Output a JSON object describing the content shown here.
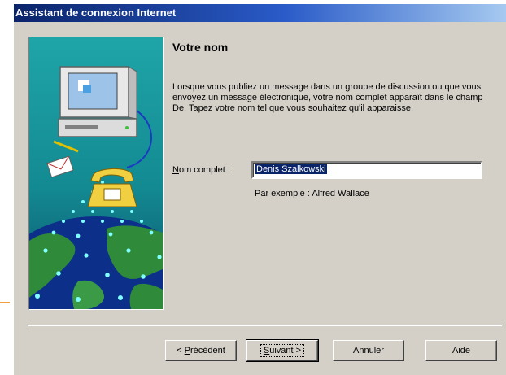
{
  "window": {
    "title": "Assistant de connexion Internet"
  },
  "page": {
    "heading": "Votre nom",
    "description": "Lorsque vous publiez un message dans un groupe de discussion ou que vous envoyez un message électronique, votre nom complet apparaît dans le champ De. Tapez votre nom tel que vous souhaitez qu'il apparaisse.",
    "name_label_accel": "N",
    "name_label_rest": "om complet :",
    "name_value": "Denis Szalkowski",
    "example": "Par exemple : Alfred Wallace"
  },
  "buttons": {
    "back_prefix": "< ",
    "back_accel": "P",
    "back_rest": "récédent",
    "next_accel": "S",
    "next_rest": "uivant >",
    "cancel": "Annuler",
    "help": "Aide"
  },
  "colors": {
    "titlebar": "#0a246a",
    "dialog_bg": "#d4d0c8",
    "selection": "#0a246a",
    "illustration_bg": "#1b9ba0"
  },
  "icons": [
    "computer-icon",
    "telephone-icon",
    "envelope-icon",
    "globe-icon"
  ]
}
